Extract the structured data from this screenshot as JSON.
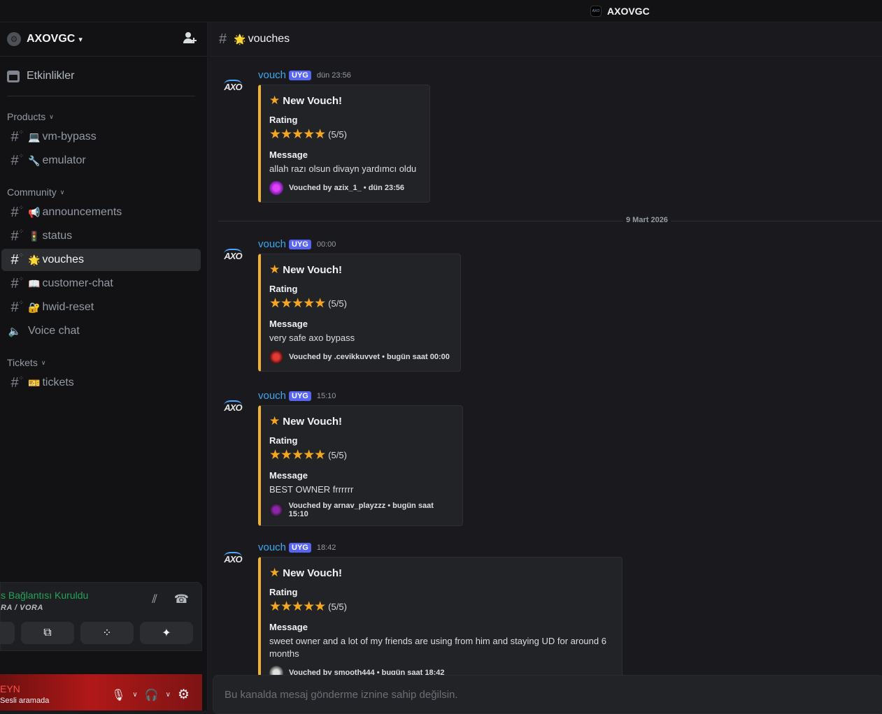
{
  "titlebar": {
    "server_name": "AXOVGC"
  },
  "sidebar": {
    "guild_name": "AXOVGC",
    "events_label": "Etkinlikler",
    "categories": [
      {
        "label": "Products",
        "channels": [
          {
            "emoji": "💻",
            "name": "vm-bypass"
          },
          {
            "emoji": "🔧",
            "name": "emulator"
          }
        ]
      },
      {
        "label": "Community",
        "channels": [
          {
            "emoji": "📢",
            "name": "announcements"
          },
          {
            "emoji": "🚦",
            "name": "status"
          },
          {
            "emoji": "🌟",
            "name": "vouches",
            "active": true
          },
          {
            "emoji": "📖",
            "name": "customer-chat"
          },
          {
            "emoji": "🔐",
            "name": "hwid-reset"
          }
        ],
        "voice_channel": "Voice chat"
      },
      {
        "label": "Tickets",
        "channels": [
          {
            "emoji": "🎫",
            "name": "tickets"
          }
        ]
      }
    ]
  },
  "voice_panel": {
    "status": "s Bağlantısı Kuruldu",
    "subtitle": "RA / VORA"
  },
  "user_panel": {
    "name": "EYN",
    "status": "Sesli aramada"
  },
  "channel_header": {
    "emoji": "🌟",
    "name": "vouches"
  },
  "messages": [
    {
      "author": "vouch",
      "tag": "UYG",
      "time": "dün 23:56",
      "embed": {
        "title": "New Vouch!",
        "rating_label": "Rating",
        "stars": "★★★★★",
        "score": "(5/5)",
        "message_label": "Message",
        "message": "allah razı olsun divayn yardımcı oldu",
        "footer": "Vouched by azix_1_ • dün 23:56"
      }
    },
    {
      "author": "vouch",
      "tag": "UYG",
      "time": "00:00",
      "embed": {
        "title": "New Vouch!",
        "rating_label": "Rating",
        "stars": "★★★★★",
        "score": "(5/5)",
        "message_label": "Message",
        "message": "very safe axo bypass",
        "footer": "Vouched by .cevikkuvvet • bugün saat 00:00"
      }
    },
    {
      "author": "vouch",
      "tag": "UYG",
      "time": "15:10",
      "embed": {
        "title": "New Vouch!",
        "rating_label": "Rating",
        "stars": "★★★★★",
        "score": "(5/5)",
        "message_label": "Message",
        "message": "BEST OWNER frrrrrr",
        "footer": "Vouched by arnav_playzzz • bugün saat 15:10"
      }
    },
    {
      "author": "vouch",
      "tag": "UYG",
      "time": "18:42",
      "embed": {
        "title": "New Vouch!",
        "rating_label": "Rating",
        "stars": "★★★★★",
        "score": "(5/5)",
        "message_label": "Message",
        "message": "sweet owner and a lot of my friends are using from him and staying UD for around 6 months",
        "footer": "Vouched by smooth444 • bugün saat 18:42"
      }
    }
  ],
  "date_divider": "9 Mart 2026",
  "composer": {
    "placeholder": "Bu kanalda mesaj gönderme iznine sahip değilsin."
  },
  "colors": {
    "accent_blurple": "#5865f2",
    "author_blue": "#3ea8ef",
    "embed_bar": "#f0b232",
    "star": "#f5a623",
    "connected_green": "#23a55a"
  }
}
